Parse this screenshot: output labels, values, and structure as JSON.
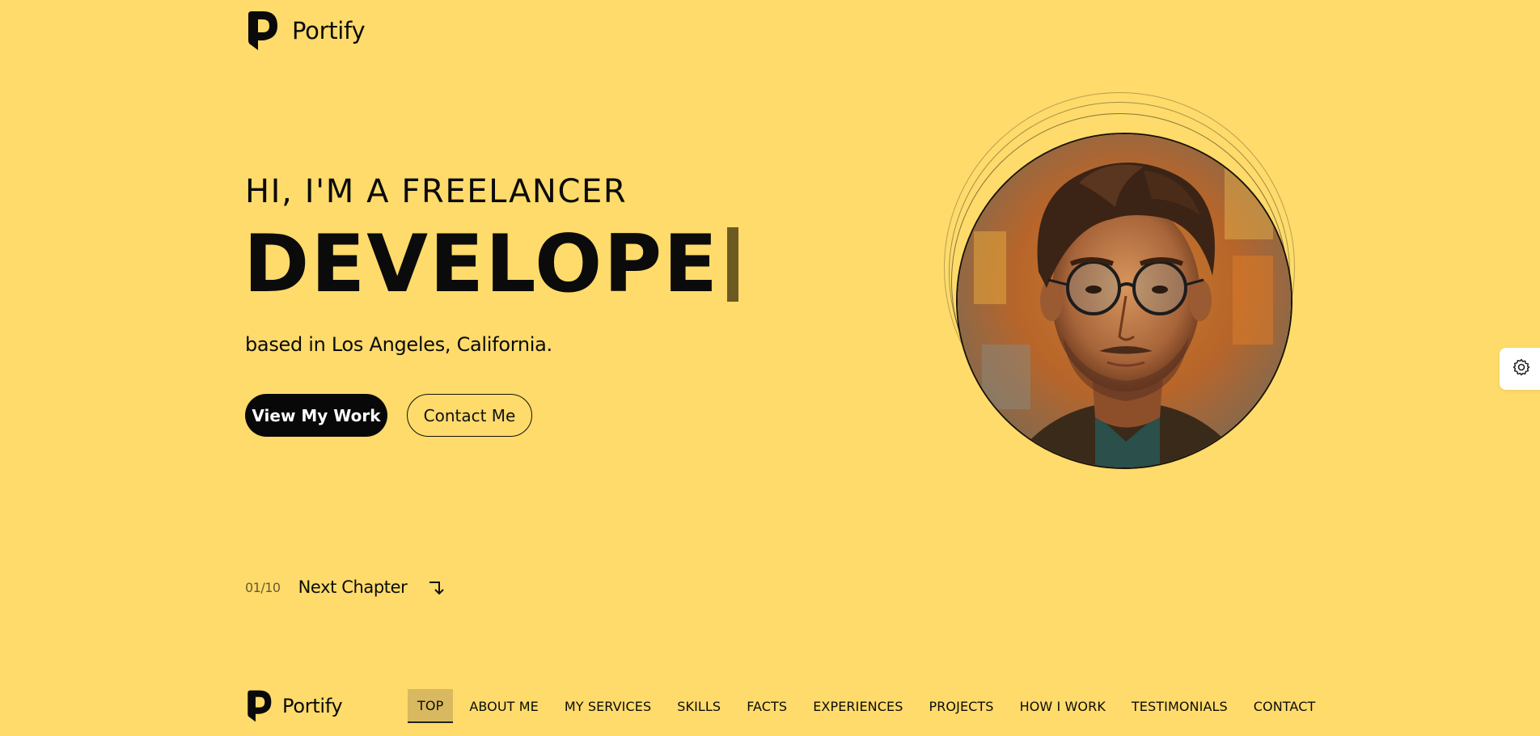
{
  "brand": {
    "name": "Portify",
    "icon": "portify-logo-icon"
  },
  "hero": {
    "greeting": "HI, I'M A FREELANCER",
    "role": "DEVELOPE",
    "location": "based in Los Angeles, California.",
    "primary_button": "View My Work",
    "secondary_button": "Contact Me"
  },
  "chapter": {
    "counter": "01/10",
    "label": "Next Chapter",
    "icon": "arrow-down-right-icon"
  },
  "settings": {
    "icon": "gear-icon"
  },
  "nav": {
    "items": [
      {
        "label": "TOP",
        "active": true
      },
      {
        "label": "ABOUT ME"
      },
      {
        "label": "MY SERVICES"
      },
      {
        "label": "SKILLS"
      },
      {
        "label": "FACTS"
      },
      {
        "label": "EXPERIENCES"
      },
      {
        "label": "PROJECTS"
      },
      {
        "label": "HOW I WORK"
      },
      {
        "label": "TESTIMONIALS"
      },
      {
        "label": "CONTACT"
      }
    ]
  },
  "colors": {
    "background": "#fedb6b",
    "text": "#0b0b0b",
    "primary_button": "#080808",
    "nav_active": "#d9b95f",
    "caret": "#6d5a22"
  }
}
